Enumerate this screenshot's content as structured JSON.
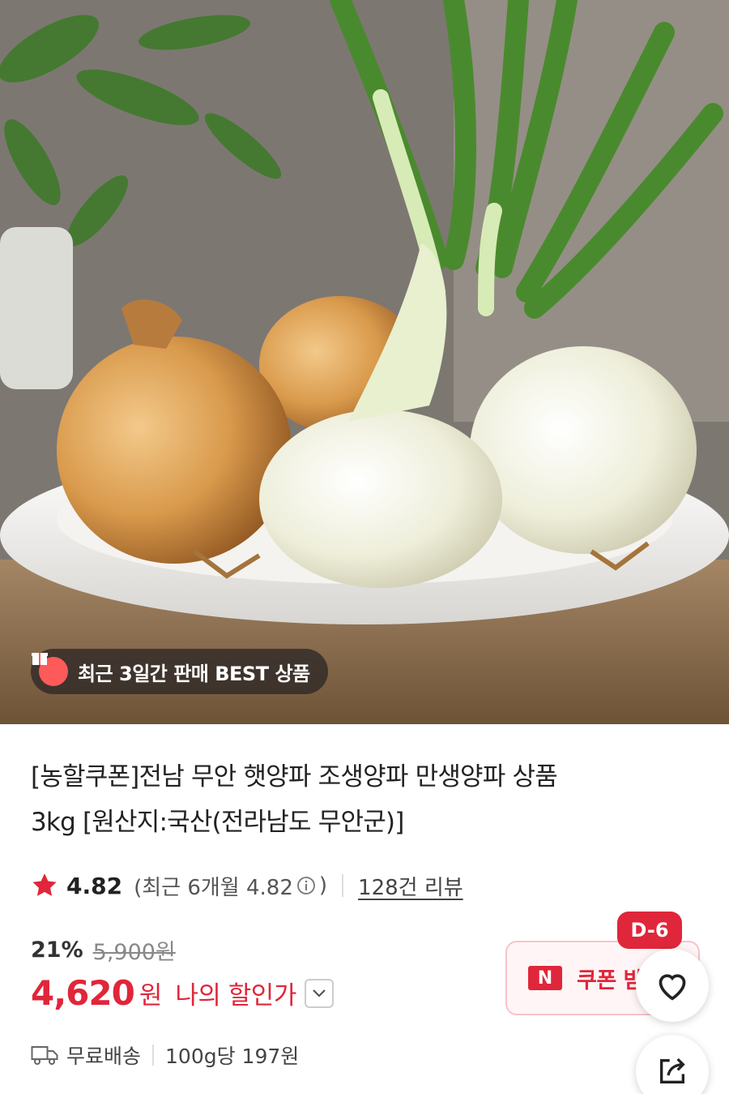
{
  "product": {
    "image_alt": "양파 상품 이미지",
    "best_badge": "최근 3일간 판매 BEST 상품",
    "title_line1": "[농할쿠폰]전남 무안 햇양파 조생양파 만생양파 상품",
    "title_line2": "3kg [원산지:국산(전라남도 무안군)]"
  },
  "rating": {
    "score": "4.82",
    "recent": "(최근 6개월 4.82",
    "recent_close": ")",
    "reviews": "128건 리뷰"
  },
  "price": {
    "discount_rate": "21%",
    "original": "5,900원",
    "current": "4,620",
    "currency": "원",
    "my_discount_label": "나의 할인가"
  },
  "shipping": {
    "free_label": "무료배송",
    "unit_price": "100g당 197원"
  },
  "coupon": {
    "d_day": "D-6",
    "logo": "N",
    "label": "쿠폰 받"
  },
  "colors": {
    "accent": "#e0263a",
    "star": "#e0263a",
    "badge_bg": "#2d2826"
  },
  "icons": [
    "gift-icon",
    "star-icon",
    "info-icon",
    "chevron-down-icon",
    "truck-icon",
    "heart-icon",
    "share-icon"
  ]
}
